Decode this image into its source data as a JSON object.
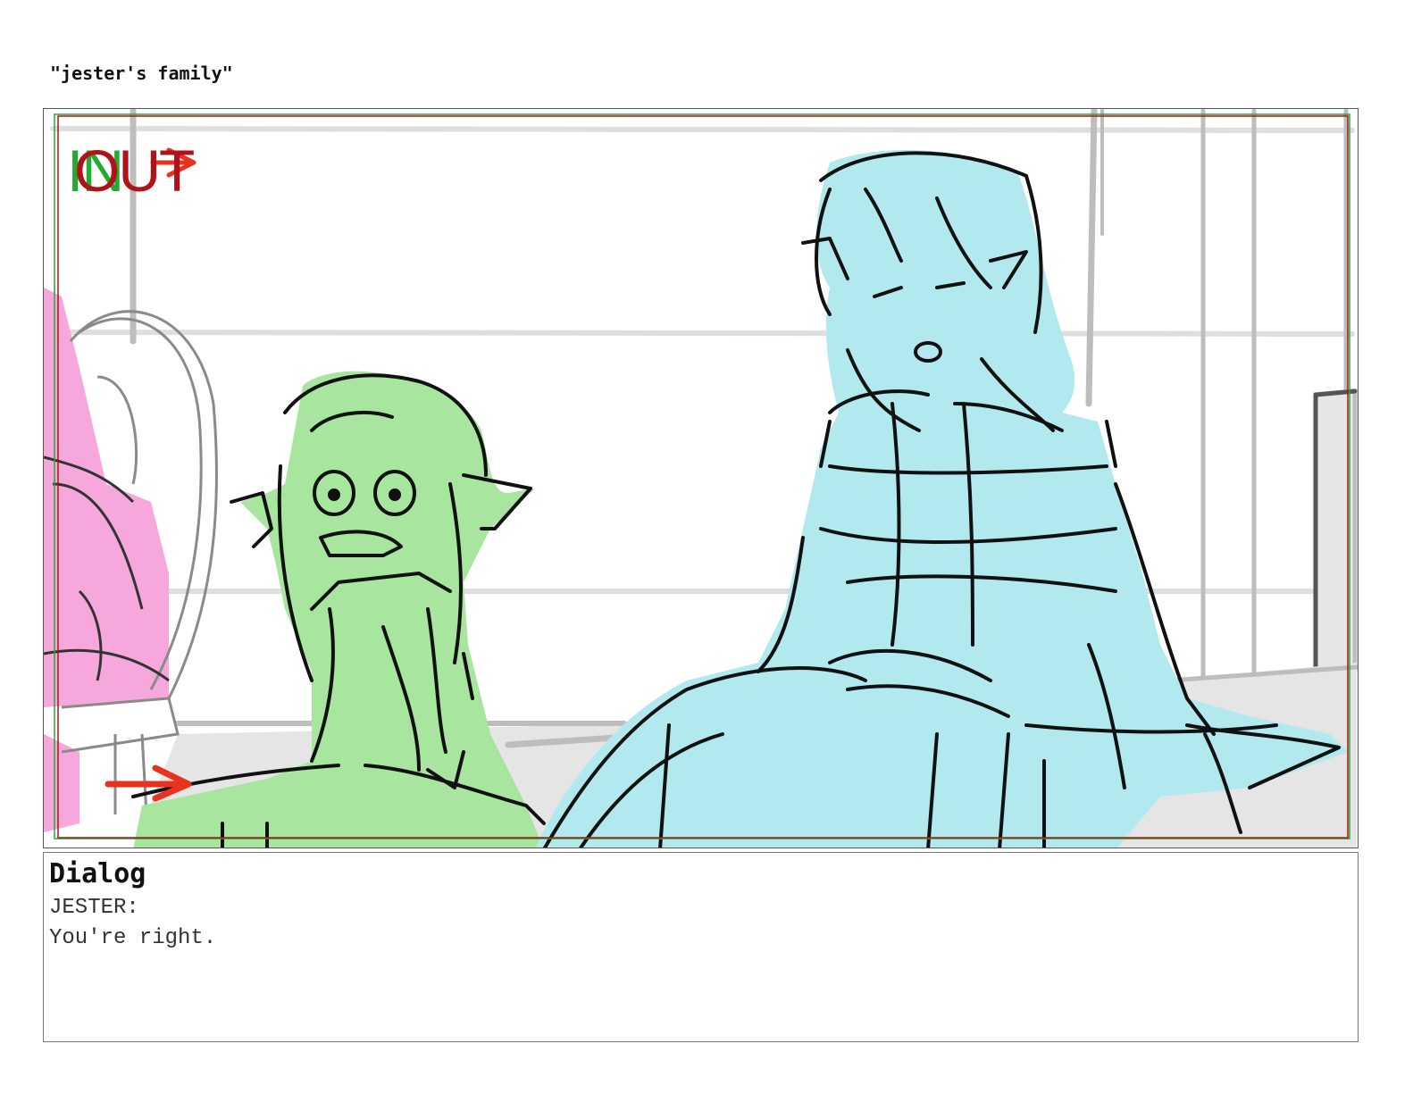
{
  "scene_title": "\"jester's family\"",
  "panel": {
    "transition_in": "IN",
    "transition_out": "OUT",
    "colors": {
      "in_marker": "#22aa33",
      "out_marker": "#b0121a",
      "pan_arrow": "#e8321e",
      "green_character": "#a8e6a0",
      "blue_character": "#b2e9ee",
      "pink_character": "#f6a8dc"
    }
  },
  "dialog": {
    "heading": "Dialog",
    "speaker": "JESTER:",
    "line": "You're right."
  }
}
